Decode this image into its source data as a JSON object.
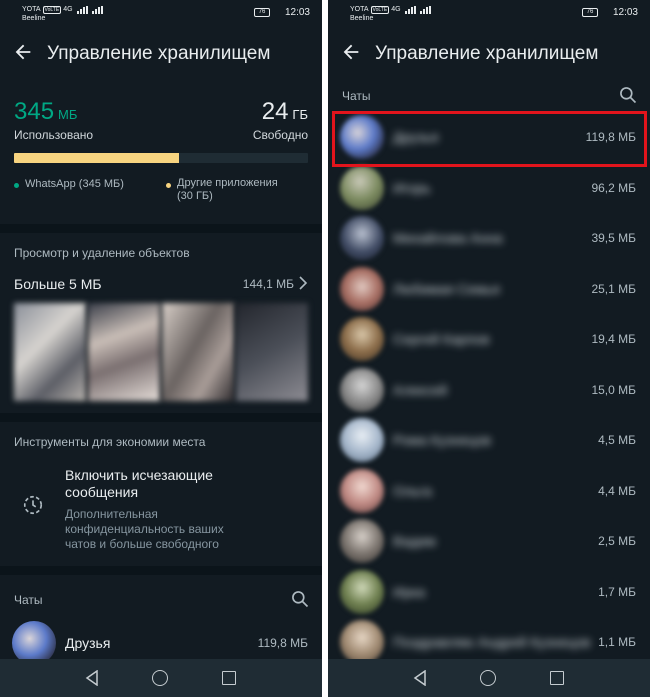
{
  "status_left": {
    "carrier1": "YOTA",
    "volte": "VoLTE",
    "net": "4G",
    "carrier2": "Beeline",
    "battery": "76",
    "time": "12:03"
  },
  "status_right": {
    "carrier1": "YOTA",
    "volte": "VoLTE",
    "net": "4G",
    "carrier2": "Beeline",
    "battery": "76",
    "time": "12:03"
  },
  "app": {
    "title": "Управление хранилищем"
  },
  "left": {
    "used_value": "345",
    "used_unit": "МБ",
    "used_label": "Использовано",
    "free_value": "24",
    "free_unit": "ГБ",
    "free_label": "Свободно",
    "usage_fraction": 0.56,
    "legend_whatsapp": "WhatsApp (345 МБ)",
    "legend_other": "Другие приложения (30 ГБ)",
    "review_title": "Просмотр и удаление объектов",
    "large_files_label": "Больше 5 МБ",
    "large_files_size": "144,1 МБ",
    "tools_title": "Инструменты для экономии места",
    "tool_title": "Включить исчезающие сообщения",
    "tool_desc": "Дополнительная конфиденциальность ваших чатов и больше свободного",
    "chats_label": "Чаты",
    "first_chat_name": "Друзья",
    "first_chat_size": "119,8 МБ"
  },
  "right": {
    "chats_label": "Чаты",
    "chats": [
      {
        "name": "Друзья",
        "size": "119,8 МБ"
      },
      {
        "name": "Игорь",
        "size": "96,2 МБ"
      },
      {
        "name": "Михайлова Анна",
        "size": "39,5 МБ"
      },
      {
        "name": "Любимая Семья",
        "size": "25,1 МБ"
      },
      {
        "name": "Сергей Карпов",
        "size": "19,4 МБ"
      },
      {
        "name": "Алексей",
        "size": "15,0 МБ"
      },
      {
        "name": "Рома Кузнецов",
        "size": "4,5 МБ"
      },
      {
        "name": "Ольга",
        "size": "4,4 МБ"
      },
      {
        "name": "Вадим",
        "size": "2,5 МБ"
      },
      {
        "name": "Ирка",
        "size": "1,7 МБ"
      },
      {
        "name": "Поздравляю Андрей Кузнецов",
        "size": "1,1 МБ"
      }
    ]
  },
  "colors": {
    "accent": "#00a884",
    "whatsapp_dot": "#00a884",
    "other_apps": "#f7d480",
    "highlight": "#e2141c",
    "background": "#121b22"
  }
}
